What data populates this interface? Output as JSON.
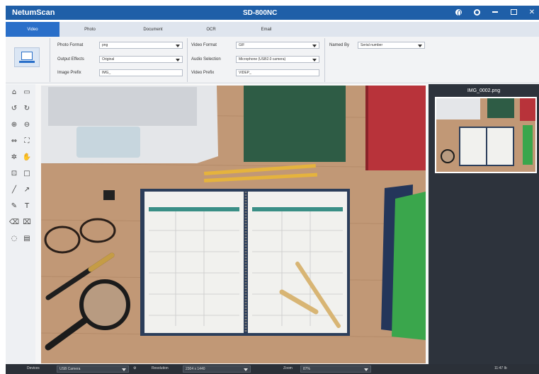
{
  "window": {
    "app_title": "NetumScan",
    "device_title": "SD-800NC",
    "icons": [
      "globe-icon",
      "gear-icon",
      "minimize-icon",
      "maximize-icon",
      "close-icon"
    ]
  },
  "tabs": [
    {
      "label": "Video",
      "active": true
    },
    {
      "label": "Photo",
      "active": false
    },
    {
      "label": "Document",
      "active": false
    },
    {
      "label": "OCR",
      "active": false
    },
    {
      "label": "Email",
      "active": false
    }
  ],
  "settings": {
    "photo_format_label": "Photo Format",
    "photo_format_value": "png",
    "output_effects_label": "Output Effects",
    "output_effects_value": "Original",
    "image_prefix_label": "Image Prefix",
    "image_prefix_value": "IMG_",
    "video_format_label": "Video Format",
    "video_format_value": "GIF",
    "audio_selection_label": "Audio Selection",
    "audio_selection_value": "Microphone (USB2.0 camera)",
    "video_prefix_label": "Video Prefix",
    "video_prefix_value": "VIDEP_",
    "named_by_label": "Named By",
    "named_by_value": "Serial number"
  },
  "thumbnail": {
    "name": "IMG_0002.png"
  },
  "statusbar": {
    "devices_label": "Devices",
    "devices_value": "USB Camera",
    "resolution_label": "Resolution",
    "resolution_value": "2304 x 1440",
    "zoom_label": "Zoom",
    "zoom_value": "87%",
    "time": "11:47 Ib"
  }
}
